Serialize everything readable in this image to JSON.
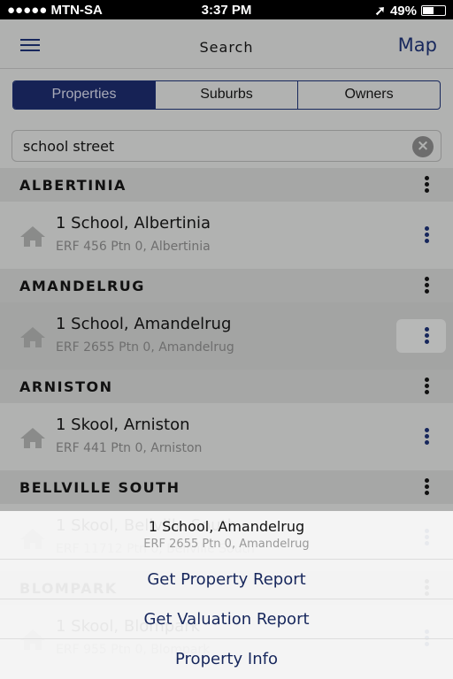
{
  "status": {
    "carrier": "●●●●● MTN-SA",
    "time": "3:37 PM",
    "battery": "49%"
  },
  "nav": {
    "title": "Search",
    "map": "Map"
  },
  "tabs": [
    {
      "label": "Properties",
      "active": true
    },
    {
      "label": "Suburbs"
    },
    {
      "label": "Owners"
    }
  ],
  "search": {
    "value": "school street"
  },
  "groups": [
    {
      "name": "ALBERTINIA",
      "title": "1 School, Albertinia",
      "sub": "ERF 456 Ptn 0, Albertinia"
    },
    {
      "name": "AMANDELRUG",
      "title": "1 School, Amandelrug",
      "sub": "ERF 2655 Ptn 0, Amandelrug",
      "selected": true
    },
    {
      "name": "ARNISTON",
      "title": "1 Skool, Arniston",
      "sub": "ERF 441 Ptn 0, Arniston"
    },
    {
      "name": "BELLVILLE SOUTH",
      "title": "1 Skool, Bellville South",
      "sub": "ERF 11712 Ptn 0, Bellville South"
    },
    {
      "name": "BLOMPARK",
      "title": "1 Skool, Blompark",
      "sub": "ERF 955 Ptn 0, Blompark"
    }
  ],
  "sheet": {
    "title": "1 School, Amandelrug",
    "subtitle": "ERF 2655 Ptn 0, Amandelrug",
    "options": [
      "Get Property Report",
      "Get Valuation Report",
      "Property Info"
    ]
  },
  "colors": {
    "accent": "#17275c"
  }
}
